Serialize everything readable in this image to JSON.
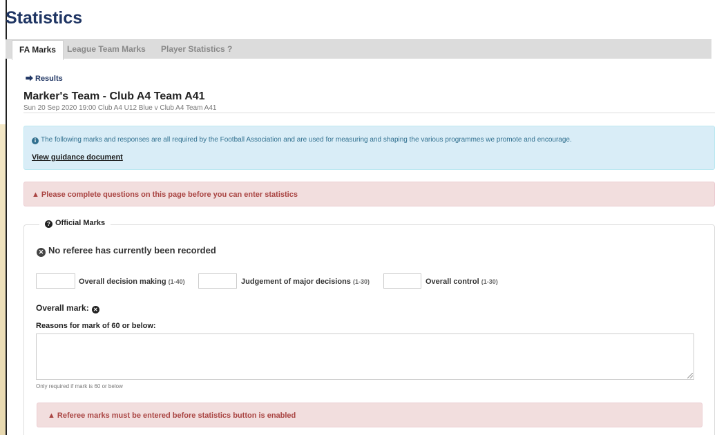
{
  "page": {
    "title": "Statistics"
  },
  "tabs": [
    {
      "label": "FA Marks",
      "active": true
    },
    {
      "label": "League Team Marks",
      "active": false
    },
    {
      "label": "Player Statistics ?",
      "active": false
    }
  ],
  "results_link": {
    "icon": "arrow-right-icon",
    "label": "Results"
  },
  "match": {
    "title": "Marker's Team - Club A4 Team A41",
    "subtitle": "Sun 20 Sep 2020 19:00 Club A4 U12 Blue v Club A4 Team A41"
  },
  "info": {
    "icon": "info-circle-icon",
    "text": "The following marks and responses are all required by the Football Association and are used for measuring and shaping the various programmes we promote and encourage.",
    "link": "View guidance document"
  },
  "alert_top": {
    "icon": "warning-icon",
    "text": "Please complete questions on this page before you can enter statistics"
  },
  "official_marks": {
    "legend": "Official Marks",
    "legend_icon": "question-circle-icon",
    "no_referee": "No referee has currently been recorded",
    "no_referee_icon": "times-circle-icon",
    "fields": [
      {
        "label": "Overall decision making",
        "range": "(1-40)",
        "value": ""
      },
      {
        "label": "Judgement of major decisions",
        "range": "(1-30)",
        "value": ""
      },
      {
        "label": "Overall control",
        "range": "(1-30)",
        "value": ""
      }
    ],
    "overall_mark_label": "Overall mark:",
    "overall_mark_icon": "times-circle-icon",
    "reasons_label": "Reasons for mark of 60 or below:",
    "reasons_value": "",
    "help_text": "Only required if mark is 60 or below",
    "alert_bottom": {
      "icon": "warning-icon",
      "text": "Referee marks must be entered before statistics button is enabled"
    }
  },
  "colors": {
    "title": "#1f3563",
    "info_bg": "#d9edf7",
    "info_text": "#31708f",
    "danger_bg": "#f2dede",
    "danger_text": "#a94442"
  }
}
